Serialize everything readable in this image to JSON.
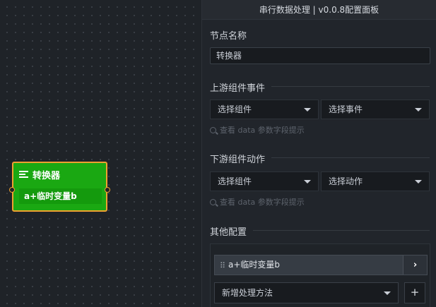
{
  "canvas": {
    "node": {
      "title": "转换器",
      "item": "a+临时变量b"
    }
  },
  "panel": {
    "title": "串行数据处理 | v0.0.8配置面板",
    "node_name": {
      "label": "节点名称",
      "value": "转换器"
    },
    "upstream": {
      "label": "上游组件事件",
      "component_select": "选择组件",
      "event_select": "选择事件",
      "hint": "查看 data 参数字段提示"
    },
    "downstream": {
      "label": "下游组件动作",
      "component_select": "选择组件",
      "action_select": "选择动作",
      "hint": "查看 data 参数字段提示"
    },
    "other": {
      "label": "其他配置",
      "process_item": "a+临时变量b",
      "expand_glyph": "›",
      "add_method_select": "新增处理方法",
      "add_button": "+"
    }
  },
  "colors": {
    "node_fill": "#1aa812",
    "node_border": "#f0a030",
    "panel_bg": "#21252b"
  }
}
